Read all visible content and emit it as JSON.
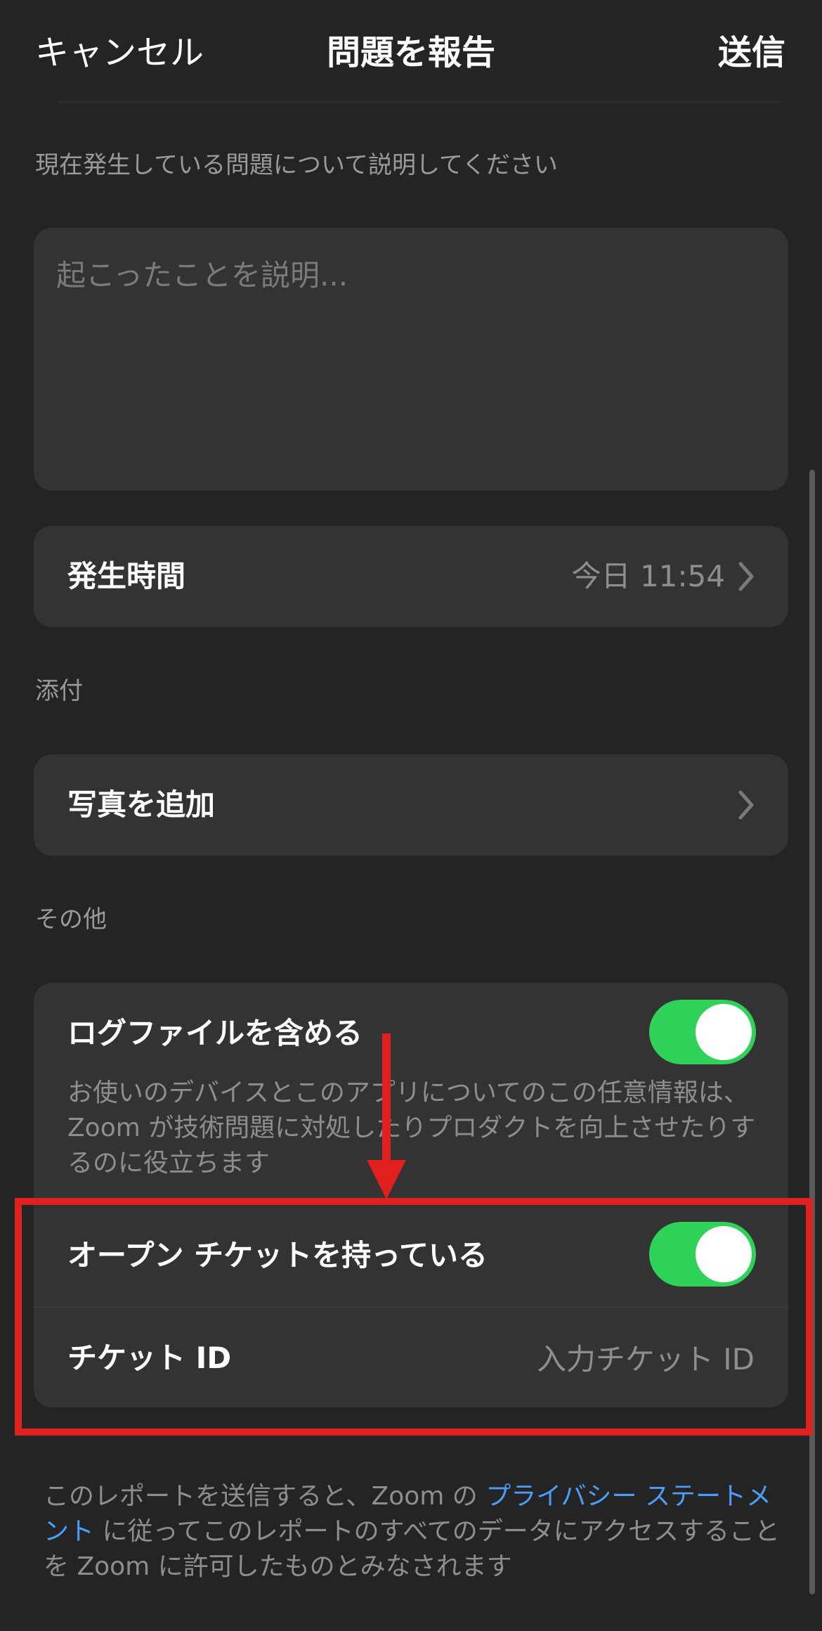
{
  "nav": {
    "cancel_label": "キャンセル",
    "title": "問題を報告",
    "send_label": "送信"
  },
  "description": {
    "section_label": "現在発生している問題について説明してください",
    "placeholder": "起こったことを説明..."
  },
  "occurrence": {
    "label": "発生時間",
    "value": "今日 11:54"
  },
  "attachments": {
    "section_label": "添付",
    "add_photo_label": "写真を追加"
  },
  "other": {
    "section_label": "その他",
    "include_logs_label": "ログファイルを含める",
    "include_logs_enabled": true,
    "include_logs_help": "お使いのデバイスとこのアプリについてのこの任意情報は、Zoom が技術問題に対処したりプロダクトを向上させたりするのに役立ちます",
    "open_ticket_label": "オープン チケットを持っている",
    "open_ticket_enabled": true,
    "ticket_id_label": "チケット ID",
    "ticket_id_placeholder": "入力チケット ID"
  },
  "footer": {
    "text_before": "このレポートを送信すると、Zoom の ",
    "link_text": "プライバシー ステートメント",
    "text_after": " に従ってこのレポートのすべてのデータにアクセスすることを Zoom に許可したものとみなされます"
  },
  "colors": {
    "background": "#242424",
    "card": "#333333",
    "toggle_on": "#30d158",
    "link": "#4a9df8",
    "annotation": "#e0201e"
  }
}
